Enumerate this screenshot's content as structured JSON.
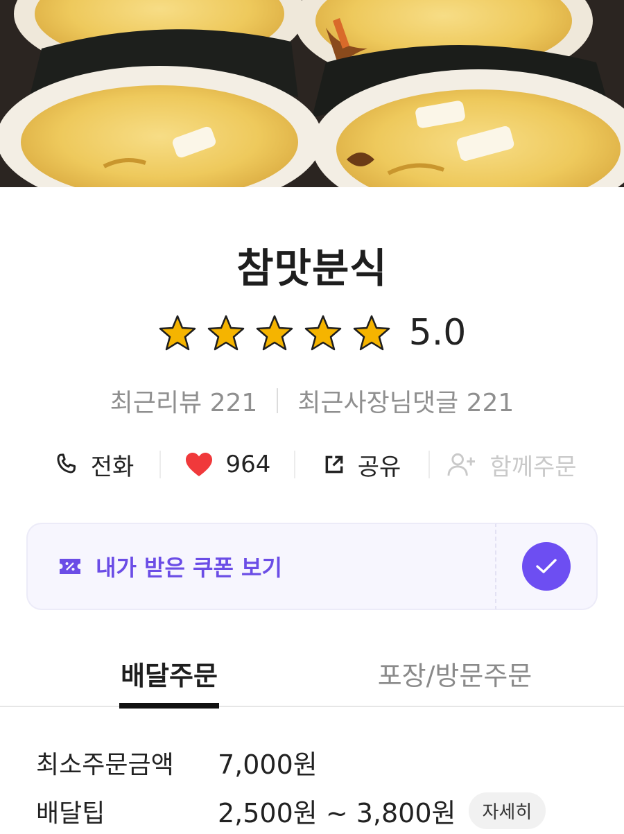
{
  "store": {
    "name": "참맛분식",
    "rating": "5.0",
    "stars_filled": 5,
    "stars_total": 5
  },
  "reviews": {
    "recent_reviews": "최근리뷰 221",
    "owner_replies": "최근사장님댓글 221"
  },
  "actions": {
    "call_label": "전화",
    "like_count": "964",
    "share_label": "공유",
    "group_order_label": "함께주문"
  },
  "coupon": {
    "label": "내가 받은 쿠폰 보기"
  },
  "tabs": [
    {
      "label": "배달주문",
      "active": true
    },
    {
      "label": "포장/방문주문",
      "active": false
    }
  ],
  "info": {
    "min_order_label": "최소주문금액",
    "min_order_value": "7,000원",
    "delivery_tip_label": "배달팁",
    "delivery_tip_value": "2,500원 ~ 3,800원",
    "detail_label": "자세히"
  },
  "icons": {
    "hero": "kimbap-photo",
    "rating": "star-icon",
    "call": "phone-icon",
    "like": "heart-icon",
    "share": "share-icon",
    "group": "add-person-icon",
    "coupon": "coupon-icon",
    "check": "check-icon"
  },
  "colors": {
    "accent": "#6d4ef2",
    "heart": "#f0393b",
    "star": "#f5b400",
    "muted": "#8f8f8f"
  }
}
